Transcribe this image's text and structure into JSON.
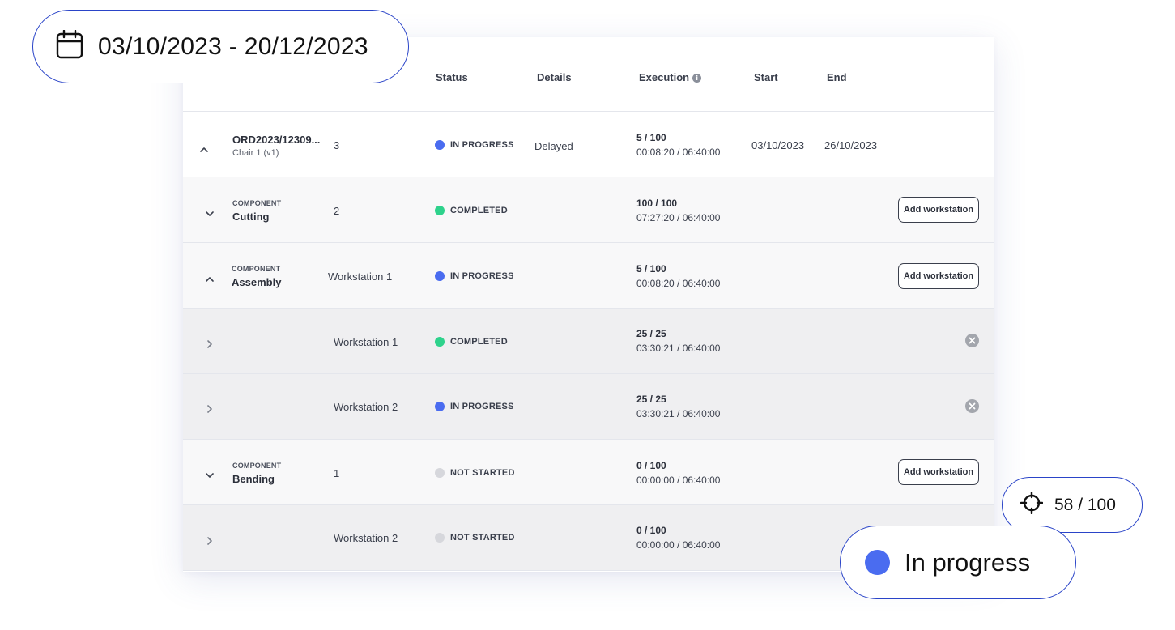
{
  "header": {
    "columns": {
      "status": "Status",
      "details": "Details",
      "execution": "Execution",
      "start": "Start",
      "end": "End"
    }
  },
  "rows": {
    "order": {
      "title": "ORD2023/12309...",
      "subtitle": "Chair 1 (v1)",
      "qty": "3",
      "status": "IN PROGRESS",
      "details": "Delayed",
      "exec_units": "5 / 100",
      "exec_time": "00:08:20 / 06:40:00",
      "start": "03/10/2023",
      "end": "26/10/2023"
    },
    "cutting": {
      "tag": "COMPONENT",
      "name": "Cutting",
      "qty": "2",
      "status": "COMPLETED",
      "exec_units": "100 / 100",
      "exec_time": "07:27:20 / 06:40:00",
      "button": "Add workstation"
    },
    "assembly": {
      "tag": "COMPONENT",
      "name": "Assembly",
      "qty": "Workstation 1",
      "status": "IN PROGRESS",
      "exec_units": "5 / 100",
      "exec_time": "00:08:20 / 06:40:00",
      "button": "Add workstation"
    },
    "assembly_ws1": {
      "name": "Workstation 1",
      "status": "COMPLETED",
      "exec_units": "25 / 25",
      "exec_time": "03:30:21 / 06:40:00"
    },
    "assembly_ws2": {
      "name": "Workstation 2",
      "status": "IN PROGRESS",
      "exec_units": "25 / 25",
      "exec_time": "03:30:21 / 06:40:00"
    },
    "bending": {
      "tag": "COMPONENT",
      "name": "Bending",
      "qty": "1",
      "status": "NOT STARTED",
      "exec_units": "0 / 100",
      "exec_time": "00:00:00 / 06:40:00",
      "button": "Add workstation"
    },
    "bending_ws2": {
      "name": "Workstation 2",
      "status": "NOT STARTED",
      "exec_units": "0 / 100",
      "exec_time": "00:00:00 / 06:40:00"
    }
  },
  "overlays": {
    "date_range": "03/10/2023 - 20/12/2023",
    "score": "58 / 100",
    "status": "In progress"
  },
  "colors": {
    "in_progress": "#4a6cf0",
    "completed": "#2ed28c",
    "not_started": "#d6d7dc",
    "pill_border": "#2a44c8"
  },
  "icons": {
    "calendar": "calendar-icon",
    "target": "crosshair-icon",
    "info": "info-icon",
    "remove": "close-circle-icon",
    "chevron_up": "chevron-up-icon",
    "chevron_down": "chevron-down-icon",
    "chevron_right": "chevron-right-icon"
  }
}
